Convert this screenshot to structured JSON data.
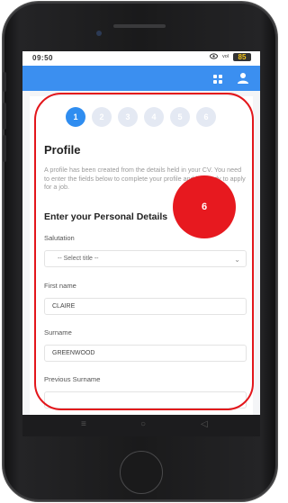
{
  "status_bar": {
    "time": "09:50",
    "icons": [
      "eye-icon",
      "signal-icon",
      "battery-icon"
    ],
    "signal_text": "ᵛᵒˡ",
    "battery_text": "85"
  },
  "app_bar": {
    "color": "#3b8ff0",
    "icons": [
      "grid-icon",
      "user-icon"
    ]
  },
  "stepper": {
    "steps": [
      "1",
      "2",
      "3",
      "4",
      "5",
      "6"
    ],
    "active_step": "1",
    "active_color": "#2f8df0"
  },
  "profile": {
    "title": "Profile",
    "intro": "A profile has been created from the details held in your CV. You need to enter the fields below to complete your profile and be ready to apply for a job.",
    "section_title": "Enter your Personal Details"
  },
  "form": {
    "salutation": {
      "label": "Salutation",
      "value": "-- Select title --"
    },
    "first_name": {
      "label": "First name",
      "value": "CLAIRE"
    },
    "surname": {
      "label": "Surname",
      "value": "GREENWOOD"
    },
    "previous_surname": {
      "label": "Previous Surname",
      "value": ""
    }
  },
  "annotation": {
    "badge_number": "6",
    "color": "#e3161b"
  },
  "nav_bar": {
    "buttons": [
      "≡",
      "○",
      "◁"
    ]
  }
}
